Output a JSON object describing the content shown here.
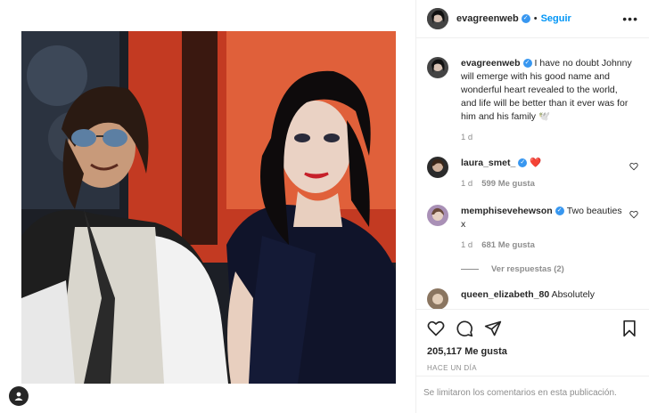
{
  "post": {
    "author": "evagreenweb",
    "follow_label": "Seguir",
    "more_label": "•••",
    "verified_mark": "✓",
    "dot": "•"
  },
  "caption": {
    "username": "evagreenweb",
    "text": "I have no doubt Johnny will emerge with his good name and wonderful heart revealed to the world, and life will be better than it ever was for him and his family 🕊️",
    "time": "1 d"
  },
  "comments": [
    {
      "username": "laura_smet_",
      "text": "❤️",
      "time": "1 d",
      "likes": "599 Me gusta"
    },
    {
      "username": "memphisevehewson",
      "text": "Two beauties x",
      "time": "1 d",
      "likes": "681 Me gusta",
      "replies_label": "Ver respuestas (2)"
    },
    {
      "username": "queen_elizabeth_80",
      "text": "Absolutely"
    }
  ],
  "footer": {
    "likes": "205,117 Me gusta",
    "time_ago": "HACE UN DÍA",
    "comments_limited": "Se limitaron los comentarios en esta publicación."
  },
  "icons": {
    "like": "heart-icon",
    "comment": "comment-icon",
    "share": "paper-plane-icon",
    "save": "bookmark-icon",
    "tagged": "user-tag-icon"
  },
  "colors": {
    "accent": "#0095f6",
    "verified": "#3897f0",
    "muted": "#8e8e8e",
    "text": "#262626",
    "heart_red": "#e0245e"
  }
}
